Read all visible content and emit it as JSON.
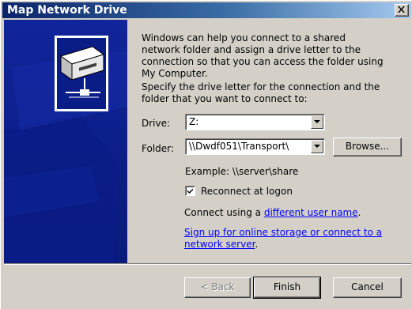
{
  "window": {
    "title": "Map Network Drive"
  },
  "intro": {
    "paragraph1": "Windows can help you connect to a shared network folder and assign a drive letter to the connection so that you can access the folder using My Computer.",
    "paragraph2": "Specify the drive letter for the connection and the folder that you want to connect to:"
  },
  "drive": {
    "label": "Drive:",
    "value": "Z:"
  },
  "folder": {
    "label": "Folder:",
    "value": "\\\\Dwdf051\\Transport\\",
    "browse_label": "Browse..."
  },
  "example_text": "Example: \\\\server\\share",
  "reconnect": {
    "label": "Reconnect at logon",
    "checked": true
  },
  "connect_using": {
    "prefix": "Connect using a ",
    "link": "different user name",
    "suffix": "."
  },
  "signup_link": {
    "line1": "Sign up for online storage or connect to a",
    "line2": "network server",
    "suffix": "."
  },
  "buttons": {
    "back": "< Back",
    "finish": "Finish",
    "cancel": "Cancel"
  },
  "icons": {
    "close": "close-icon",
    "drive": "network-drive-icon",
    "dropdown": "chevron-down-icon",
    "check": "checkmark-icon"
  },
  "colors": {
    "titlebar_start": "#0a246a",
    "titlebar_end": "#a6caf0",
    "side_panel": "#0c1f8f",
    "dialog_bg": "#d4d0c8",
    "link": "#0000ff"
  }
}
